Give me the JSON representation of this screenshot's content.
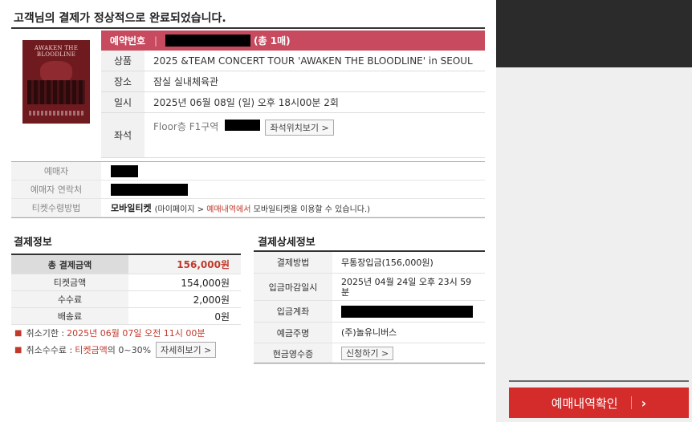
{
  "headline": "고객님의 결제가 정상적으로 완료되었습니다.",
  "poster": {
    "title": "AWAKEN THE BLOODLINE"
  },
  "booking": {
    "number_label": "예약번호",
    "number_separator": "|",
    "count": "(총 1매)"
  },
  "info": {
    "title_label": "상품",
    "title_value": "2025 &TEAM CONCERT TOUR 'AWAKEN THE BLOODLINE' in SEOUL",
    "venue_label": "장소",
    "venue_value": "잠실 실내체육관",
    "date_label": "일시",
    "date_value": "2025년 06월 08일 (일) 오후 18시00분 2회",
    "seat_label": "좌석",
    "seat_value": "Floor층 F1구역",
    "seat_button": "좌석위치보기 >"
  },
  "buyer": {
    "name_label": "예매자",
    "contact_label": "예매자 연락처",
    "method_label": "티켓수령방법",
    "method_value": "모바일티켓",
    "method_note_pre": "(마이페이지 > ",
    "method_note_hl": "예매내역에서",
    "method_note_post": " 모바일티켓을 이용할 수 있습니다.)"
  },
  "payment": {
    "title": "결제정보",
    "rows": [
      {
        "label": "총 결제금액",
        "value": "156,000원"
      },
      {
        "label": "티켓금액",
        "value": "154,000원"
      },
      {
        "label": "수수료",
        "value": "2,000원"
      },
      {
        "label": "배송료",
        "value": "0원"
      }
    ],
    "cancel_label": "취소기한 :",
    "cancel_value": "2025년 06월 07일 오전 11시 00분",
    "fee_label": "취소수수료 :",
    "fee_value_red": "티켓금액",
    "fee_value_plain": "의 0~30%",
    "fee_button": "자세히보기 >"
  },
  "payment_detail": {
    "title": "결제상세정보",
    "method_label": "결제방법",
    "method_value": "무통장입금(156,000원)",
    "deadline_label": "입금마감일시",
    "deadline_value": "2025년 04월 24일 오후 23시 59분",
    "account_label": "입금계좌",
    "holder_label": "예금주명",
    "holder_value": "(주)놀유니버스",
    "receipt_label": "현금영수증",
    "receipt_button": "신청하기 >"
  },
  "side": {
    "confirm_button": "예매내역확인",
    "confirm_chevron": "›"
  },
  "colors": {
    "accent_bar": "#c74a5e",
    "primary_button": "#d42b2b",
    "highlight_text": "#c0392b"
  }
}
